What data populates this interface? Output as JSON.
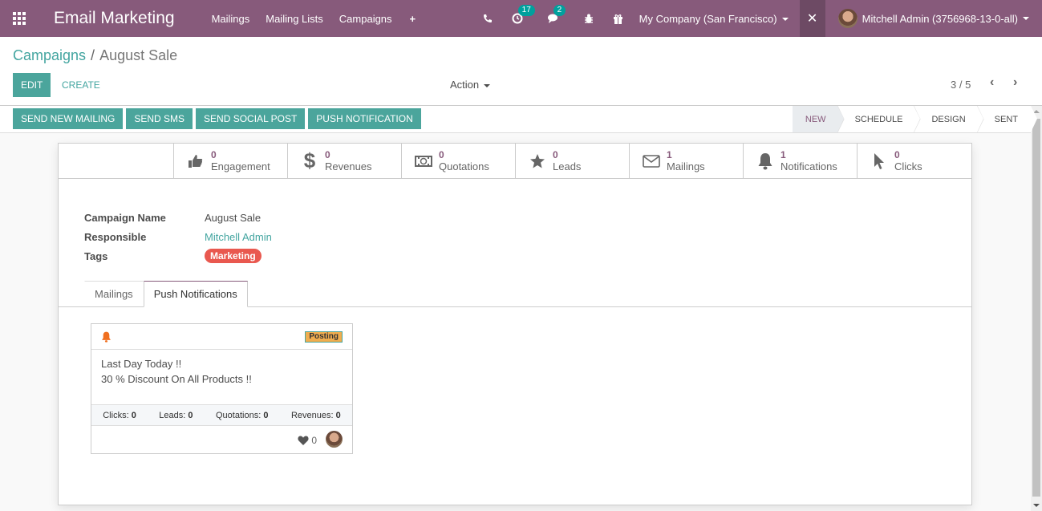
{
  "navbar": {
    "app_title": "Email Marketing",
    "menu": [
      "Mailings",
      "Mailing Lists",
      "Campaigns"
    ],
    "activity_count": "17",
    "messages_count": "2",
    "company": "My Company (San Francisco)",
    "user": "Mitchell Admin (3756968-13-0-all)"
  },
  "breadcrumb": {
    "parent": "Campaigns",
    "separator": "/",
    "current": "August Sale"
  },
  "toolbar": {
    "edit": "EDIT",
    "create": "CREATE",
    "action": "Action",
    "pager": "3 / 5"
  },
  "header_buttons": [
    "SEND NEW MAILING",
    "SEND SMS",
    "SEND SOCIAL POST",
    "PUSH NOTIFICATION"
  ],
  "stages": [
    {
      "label": "NEW",
      "active": true
    },
    {
      "label": "SCHEDULE",
      "active": false
    },
    {
      "label": "DESIGN",
      "active": false
    },
    {
      "label": "SENT",
      "active": false
    }
  ],
  "stat_buttons": [
    {
      "icon": "thumbs-up-icon",
      "value": "0",
      "label": "Engagement"
    },
    {
      "icon": "dollar-icon",
      "value": "0",
      "label": "Revenues"
    },
    {
      "icon": "money-icon",
      "value": "0",
      "label": "Quotations"
    },
    {
      "icon": "star-icon",
      "value": "0",
      "label": "Leads"
    },
    {
      "icon": "envelope-icon",
      "value": "1",
      "label": "Mailings"
    },
    {
      "icon": "bell-icon",
      "value": "1",
      "label": "Notifications"
    },
    {
      "icon": "pointer-icon",
      "value": "0",
      "label": "Clicks"
    }
  ],
  "fields": {
    "campaign_name_label": "Campaign Name",
    "campaign_name": "August Sale",
    "responsible_label": "Responsible",
    "responsible": "Mitchell Admin",
    "tags_label": "Tags",
    "tag": "Marketing"
  },
  "tabs": [
    {
      "label": "Mailings",
      "active": false
    },
    {
      "label": "Push Notifications",
      "active": true
    }
  ],
  "card": {
    "status": "Posting",
    "line1": "Last Day Today !!",
    "line2": "30 % Discount On All Products !!",
    "stats": [
      {
        "label": "Clicks:",
        "value": "0"
      },
      {
        "label": "Leads:",
        "value": "0"
      },
      {
        "label": "Quotations:",
        "value": "0"
      },
      {
        "label": "Revenues:",
        "value": "0"
      }
    ],
    "likes": "0"
  },
  "colors": {
    "brand": "#875a7b",
    "primary": "#4ba59c",
    "tag": "#e9584f",
    "posting": "#f0ad4e"
  }
}
